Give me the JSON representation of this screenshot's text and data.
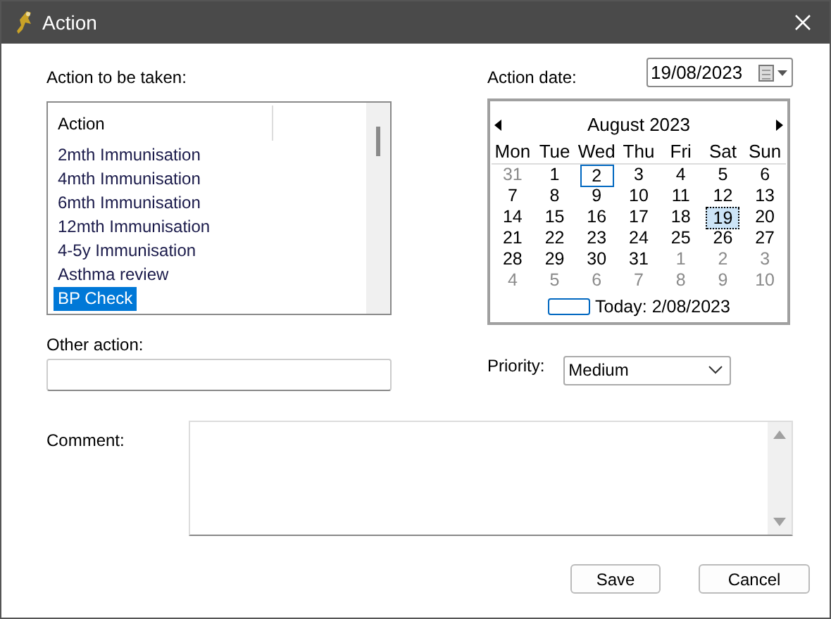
{
  "window": {
    "title": "Action"
  },
  "action_list": {
    "label": "Action to be taken:",
    "column": "Action",
    "items": [
      {
        "text": "2mth Immunisation",
        "selected": false
      },
      {
        "text": "4mth Immunisation",
        "selected": false
      },
      {
        "text": "6mth Immunisation",
        "selected": false
      },
      {
        "text": "12mth Immunisation",
        "selected": false
      },
      {
        "text": "4-5y Immunisation",
        "selected": false
      },
      {
        "text": "Asthma review",
        "selected": false
      },
      {
        "text": "BP Check",
        "selected": true
      }
    ]
  },
  "action_date": {
    "label": "Action date:",
    "value": "19/08/2023"
  },
  "calendar": {
    "month": "August 2023",
    "weekdays": [
      "Mon",
      "Tue",
      "Wed",
      "Thu",
      "Fri",
      "Sat",
      "Sun"
    ],
    "weeks": [
      [
        {
          "day": "31",
          "other_month": true,
          "today": false,
          "selected": false
        },
        {
          "day": "1",
          "other_month": false,
          "today": false,
          "selected": false
        },
        {
          "day": "2",
          "other_month": false,
          "today": true,
          "selected": false
        },
        {
          "day": "3",
          "other_month": false,
          "today": false,
          "selected": false
        },
        {
          "day": "4",
          "other_month": false,
          "today": false,
          "selected": false
        },
        {
          "day": "5",
          "other_month": false,
          "today": false,
          "selected": false
        },
        {
          "day": "6",
          "other_month": false,
          "today": false,
          "selected": false
        }
      ],
      [
        {
          "day": "7",
          "other_month": false,
          "today": false,
          "selected": false
        },
        {
          "day": "8",
          "other_month": false,
          "today": false,
          "selected": false
        },
        {
          "day": "9",
          "other_month": false,
          "today": false,
          "selected": false
        },
        {
          "day": "10",
          "other_month": false,
          "today": false,
          "selected": false
        },
        {
          "day": "11",
          "other_month": false,
          "today": false,
          "selected": false
        },
        {
          "day": "12",
          "other_month": false,
          "today": false,
          "selected": false
        },
        {
          "day": "13",
          "other_month": false,
          "today": false,
          "selected": false
        }
      ],
      [
        {
          "day": "14",
          "other_month": false,
          "today": false,
          "selected": false
        },
        {
          "day": "15",
          "other_month": false,
          "today": false,
          "selected": false
        },
        {
          "day": "16",
          "other_month": false,
          "today": false,
          "selected": false
        },
        {
          "day": "17",
          "other_month": false,
          "today": false,
          "selected": false
        },
        {
          "day": "18",
          "other_month": false,
          "today": false,
          "selected": false
        },
        {
          "day": "19",
          "other_month": false,
          "today": false,
          "selected": true
        },
        {
          "day": "20",
          "other_month": false,
          "today": false,
          "selected": false
        }
      ],
      [
        {
          "day": "21",
          "other_month": false,
          "today": false,
          "selected": false
        },
        {
          "day": "22",
          "other_month": false,
          "today": false,
          "selected": false
        },
        {
          "day": "23",
          "other_month": false,
          "today": false,
          "selected": false
        },
        {
          "day": "24",
          "other_month": false,
          "today": false,
          "selected": false
        },
        {
          "day": "25",
          "other_month": false,
          "today": false,
          "selected": false
        },
        {
          "day": "26",
          "other_month": false,
          "today": false,
          "selected": false
        },
        {
          "day": "27",
          "other_month": false,
          "today": false,
          "selected": false
        }
      ],
      [
        {
          "day": "28",
          "other_month": false,
          "today": false,
          "selected": false
        },
        {
          "day": "29",
          "other_month": false,
          "today": false,
          "selected": false
        },
        {
          "day": "30",
          "other_month": false,
          "today": false,
          "selected": false
        },
        {
          "day": "31",
          "other_month": false,
          "today": false,
          "selected": false
        },
        {
          "day": "1",
          "other_month": true,
          "today": false,
          "selected": false
        },
        {
          "day": "2",
          "other_month": true,
          "today": false,
          "selected": false
        },
        {
          "day": "3",
          "other_month": true,
          "today": false,
          "selected": false
        }
      ],
      [
        {
          "day": "4",
          "other_month": true,
          "today": false,
          "selected": false
        },
        {
          "day": "5",
          "other_month": true,
          "today": false,
          "selected": false
        },
        {
          "day": "6",
          "other_month": true,
          "today": false,
          "selected": false
        },
        {
          "day": "7",
          "other_month": true,
          "today": false,
          "selected": false
        },
        {
          "day": "8",
          "other_month": true,
          "today": false,
          "selected": false
        },
        {
          "day": "9",
          "other_month": true,
          "today": false,
          "selected": false
        },
        {
          "day": "10",
          "other_month": true,
          "today": false,
          "selected": false
        }
      ]
    ],
    "today_text": "Today: 2/08/2023"
  },
  "other_action": {
    "label": "Other action:"
  },
  "priority": {
    "label": "Priority:",
    "value": "Medium"
  },
  "comment": {
    "label": "Comment:"
  },
  "buttons": [
    "Save",
    "Cancel"
  ]
}
